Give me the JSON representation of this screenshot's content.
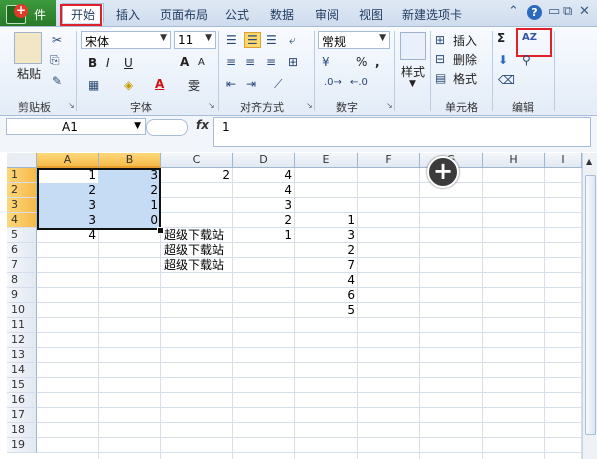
{
  "tabs": {
    "file": "件",
    "home": "开始",
    "insert": "插入",
    "page_layout": "页面布局",
    "formulas": "公式",
    "data": "数据",
    "review": "审阅",
    "view": "视图",
    "new_tab": "新建选项卡"
  },
  "ribbon": {
    "clipboard": {
      "paste": "粘贴",
      "label": "剪贴板"
    },
    "font": {
      "name": "宋体",
      "size": "11",
      "label": "字体",
      "bold": "B",
      "italic": "I",
      "underline": "U",
      "grow": "A",
      "shrink": "A",
      "color_a": "A",
      "wen": "雯"
    },
    "alignment": {
      "label": "对齐方式"
    },
    "number": {
      "format": "常规",
      "percent": "%",
      "comma": ",",
      "label": "数字"
    },
    "styles": {
      "label": "样式"
    },
    "cells": {
      "insert": "插入",
      "delete": "删除",
      "format": "格式",
      "label": "单元格"
    },
    "editing": {
      "sigma": "Σ",
      "sort": "AZ",
      "label": "编辑"
    }
  },
  "formula_bar": {
    "name_box": "A1",
    "fx": "fx",
    "value": "1"
  },
  "columns": [
    "A",
    "B",
    "C",
    "D",
    "E",
    "F",
    "G",
    "H",
    "I"
  ],
  "rows": [
    "1",
    "2",
    "3",
    "4",
    "5",
    "6",
    "7",
    "8",
    "9",
    "10",
    "11",
    "12",
    "13",
    "14",
    "15",
    "16",
    "17",
    "18",
    "19"
  ],
  "cells": {
    "A1": "1",
    "B1": "3",
    "C1": "2",
    "D1": "4",
    "A2": "2",
    "B2": "2",
    "D2": "4",
    "A3": "3",
    "B3": "1",
    "D3": "3",
    "A4": "3",
    "B4": "0",
    "D4": "2",
    "E4": "1",
    "A5": "4",
    "C5": "超级下载站",
    "D5": "1",
    "E5": "3",
    "C6": "超级下载站",
    "E6": "2",
    "C7": "超级下载站",
    "E7": "7",
    "E8": "4",
    "E9": "6",
    "E10": "5"
  },
  "overlay": {
    "add_symbol": "+"
  }
}
